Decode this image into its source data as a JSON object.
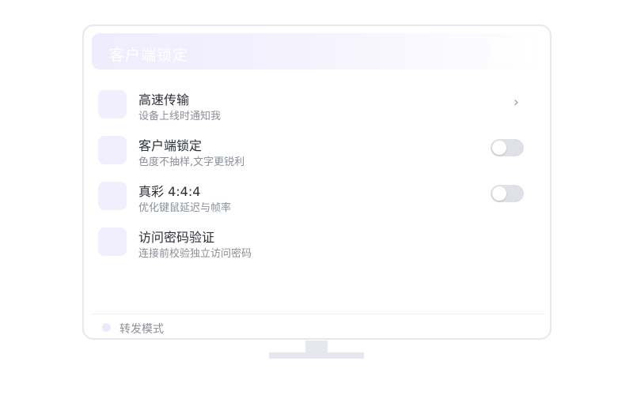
{
  "header": {
    "title": "客户端锁定"
  },
  "settings": [
    {
      "title": "高速传输",
      "subtitle": "设备上线时通知我",
      "control": "chevron",
      "chevron_glyph": "›"
    },
    {
      "title": "客户端锁定",
      "subtitle": "色度不抽样,文字更锐利",
      "control": "toggle",
      "enabled": false
    },
    {
      "title": "真彩 4:4:4",
      "subtitle": "优化键鼠延迟与帧率",
      "control": "toggle",
      "enabled": false
    },
    {
      "title": "访问密码验证",
      "subtitle": "连接前校验独立访问密码",
      "control": "none"
    }
  ],
  "footer": {
    "mode_label": "转发模式"
  },
  "colors": {
    "accent_light": "#f1eefd",
    "toggle_off": "#dfe1e6",
    "title_text": "#2b2f36",
    "sub_text": "#8a8f98"
  }
}
